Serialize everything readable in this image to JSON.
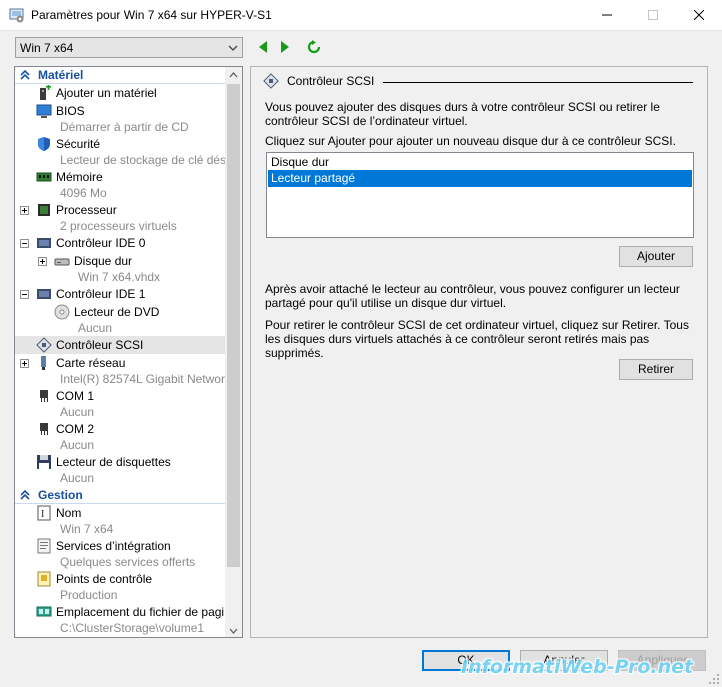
{
  "window": {
    "title": "Paramètres pour Win 7 x64 sur HYPER-V-S1"
  },
  "toolbar": {
    "vm_selected": "Win 7 x64"
  },
  "sidebar": {
    "section_hardware": "Matériel",
    "section_management": "Gestion",
    "items": [
      {
        "name": "Ajouter un matériel",
        "sub": ""
      },
      {
        "name": "BIOS",
        "sub": "Démarrer à partir de CD"
      },
      {
        "name": "Sécurité",
        "sub": "Lecteur de stockage de clé dés..."
      },
      {
        "name": "Mémoire",
        "sub": "4096 Mo"
      },
      {
        "name": "Processeur",
        "sub": "2 processeurs virtuels"
      },
      {
        "name": "Contrôleur IDE 0",
        "sub": ""
      },
      {
        "name": "Disque dur",
        "sub": "Win 7 x64.vhdx"
      },
      {
        "name": "Contrôleur IDE 1",
        "sub": ""
      },
      {
        "name": "Lecteur de DVD",
        "sub": "Aucun"
      },
      {
        "name": "Contrôleur SCSI",
        "sub": ""
      },
      {
        "name": "Carte réseau",
        "sub": "Intel(R) 82574L Gigabit Networ..."
      },
      {
        "name": "COM 1",
        "sub": "Aucun"
      },
      {
        "name": "COM 2",
        "sub": "Aucun"
      },
      {
        "name": "Lecteur de disquettes",
        "sub": "Aucun"
      },
      {
        "name": "Nom",
        "sub": "Win 7 x64"
      },
      {
        "name": "Services d’intégration",
        "sub": "Quelques services offerts"
      },
      {
        "name": "Points de contrôle",
        "sub": "Production"
      },
      {
        "name": "Emplacement du fichier de pagi...",
        "sub": "C:\\ClusterStorage\\volume1"
      }
    ]
  },
  "main": {
    "header": "Contrôleur SCSI",
    "intro": "Vous pouvez ajouter des disques durs à votre contrôleur SCSI ou retirer le contrôleur SCSI de l’ordinateur virtuel.",
    "instruction": "Cliquez sur Ajouter pour ajouter un nouveau disque dur à ce contrôleur SCSI.",
    "options": [
      "Disque dur",
      "Lecteur partagé"
    ],
    "selected_option": "Lecteur partagé",
    "add_button": "Ajouter",
    "after_attach": "Après avoir attaché le lecteur au contrôleur, vous pouvez configurer un lecteur partagé pour qu'il utilise un disque dur virtuel.",
    "remove_info": "Pour retirer le contrôleur SCSI de cet ordinateur virtuel, cliquez sur Retirer. Tous les disques durs virtuels attachés à ce contrôleur seront retirés mais pas supprimés.",
    "remove_button": "Retirer"
  },
  "footer": {
    "ok": "OK",
    "cancel": "Annuler",
    "apply": "Appliquer"
  },
  "watermark": "InformatiWeb-Pro.net",
  "colors": {
    "selection": "#0078d7",
    "section_text": "#1a50a0",
    "nav_green": "#1a9a1a"
  }
}
